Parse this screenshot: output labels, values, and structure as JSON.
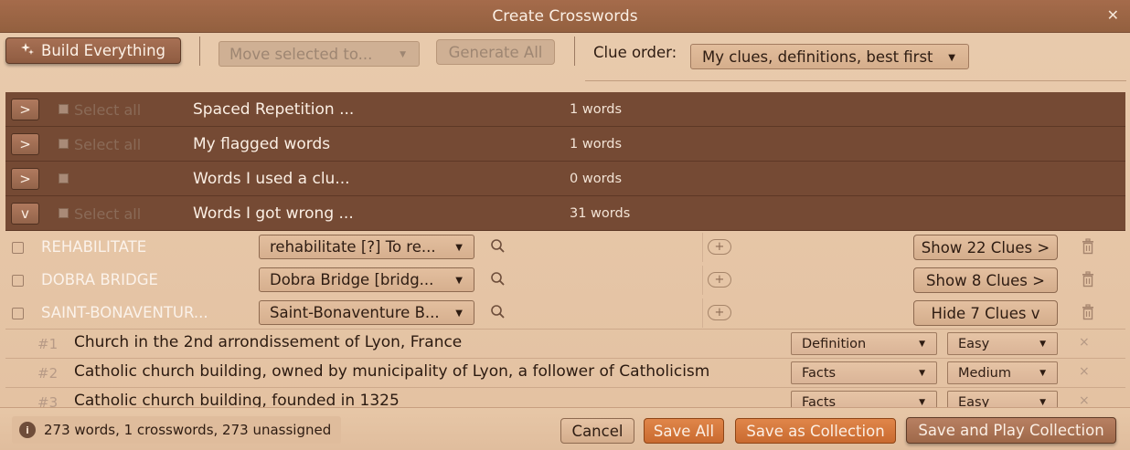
{
  "window": {
    "title": "Create Crosswords",
    "close_glyph": "✕"
  },
  "toolbar": {
    "build_label": "Build Everything",
    "move_placeholder": "Move selected to...",
    "generate_label": "Generate All",
    "clue_order_label": "Clue order:",
    "clue_order_value": "My clues, definitions, best first"
  },
  "groups": [
    {
      "toggle": ">",
      "select_label": "Select all",
      "name": "Spaced Repetition ...",
      "count": "1 words"
    },
    {
      "toggle": ">",
      "select_label": "Select all",
      "name": "My flagged words",
      "count": "1 words"
    },
    {
      "toggle": ">",
      "select_label": "",
      "name": "Words I used a clu...",
      "count": "0 words"
    },
    {
      "toggle": "v",
      "select_label": "Select all",
      "name": "Words I got wrong ...",
      "count": "31 words"
    }
  ],
  "words": [
    {
      "name": "REHABILITATE",
      "definition": "rehabilitate [?] To re...",
      "clues_button": "Show 22 Clues >"
    },
    {
      "name": "DOBRA BRIDGE",
      "definition": "Dobra Bridge [bridg...",
      "clues_button": "Show 8 Clues >"
    },
    {
      "name": "SAINT-BONAVENTUR...",
      "definition": "Saint-Bonaventure B...",
      "clues_button": "Hide 7 Clues v"
    }
  ],
  "plus_glyph": "+",
  "clues": [
    {
      "num": "#1",
      "text": "Church in the 2nd arrondissement of Lyon, France",
      "type": "Definition",
      "difficulty": "Easy",
      "remove_glyph": "×"
    },
    {
      "num": "#2",
      "text": "Catholic church building, owned by municipality of Lyon, a follower of Catholicism",
      "type": "Facts",
      "difficulty": "Medium",
      "remove_glyph": "×"
    },
    {
      "num": "#3",
      "text": "Catholic church building, founded in 1325",
      "type": "Facts",
      "difficulty": "Easy",
      "remove_glyph": "×"
    }
  ],
  "footer": {
    "info_glyph": "i",
    "status": "273 words, 1 crosswords, 273 unassigned",
    "cancel": "Cancel",
    "save_all": "Save All",
    "save_collection": "Save as Collection",
    "save_play": "Save and Play Collection"
  },
  "colors": {
    "accent_orange": "#d5763a",
    "group_row": "#754a34",
    "background": "#e6c6a6"
  },
  "icons": {
    "build": "sparkle-icon",
    "search": "search-icon",
    "add": "plus-circle-icon",
    "delete": "trash-icon",
    "close": "close-icon",
    "info": "info-icon"
  }
}
